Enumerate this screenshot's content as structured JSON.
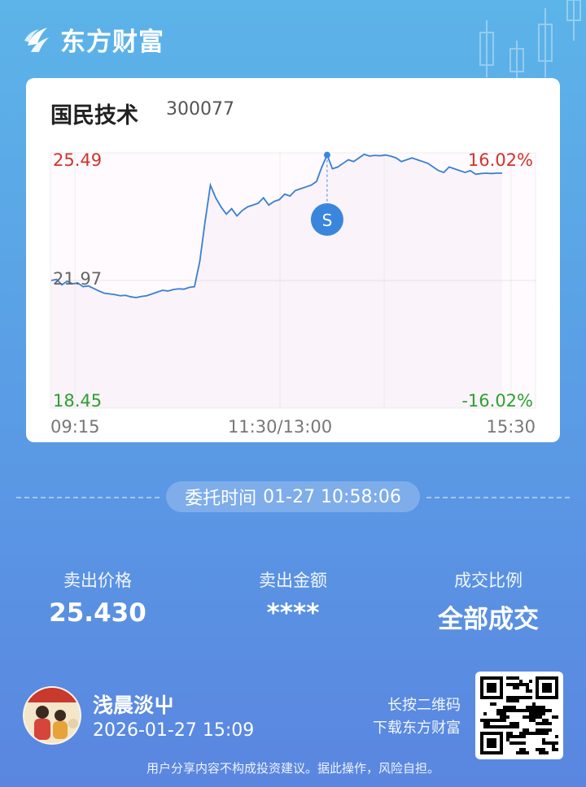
{
  "brand": {
    "name": "东方财富",
    "accent": "#ffffff"
  },
  "stock": {
    "name": "国民技术",
    "code": "300077"
  },
  "chart_data": {
    "type": "line",
    "y_left_ticks": [
      "25.49",
      "21.97",
      "18.45"
    ],
    "y_right_ticks": [
      "16.02%",
      "",
      "-16.02%"
    ],
    "x_ticks": [
      "09:15",
      "11:30/13:00",
      "15:30"
    ],
    "ylim": [
      18.45,
      25.49
    ],
    "prev_close": 21.97,
    "line_color": "#3a7fd0",
    "up_color": "#d0342c",
    "down_color": "#2ea02e",
    "marker": {
      "label": "S",
      "price": 25.43,
      "color": "#3a86dc"
    },
    "series": [
      {
        "values": [
          21.97,
          22.0,
          21.85,
          21.95,
          21.88,
          21.9,
          21.8,
          21.82,
          21.75,
          21.68,
          21.62,
          21.6,
          21.58,
          21.55,
          21.56,
          21.52,
          21.5,
          21.53,
          21.55,
          21.6,
          21.65,
          21.7,
          21.68,
          21.72,
          21.74,
          21.73,
          21.78,
          21.8,
          22.5,
          23.6,
          24.6,
          24.25,
          24.0,
          23.8,
          23.95,
          23.75,
          23.9,
          24.0,
          24.05,
          24.1,
          24.25,
          24.05,
          24.15,
          24.2,
          24.35,
          24.3,
          24.45,
          24.5,
          24.55,
          24.6,
          24.7,
          25.1,
          25.43,
          25.05,
          25.1,
          25.2,
          25.3,
          25.25,
          25.35,
          25.45,
          25.4,
          25.42,
          25.41,
          25.43,
          25.4,
          25.35,
          25.25,
          25.3,
          25.35,
          25.3,
          25.25,
          25.2,
          25.1,
          25.0,
          24.95,
          25.1,
          25.05,
          25.0,
          24.95,
          25.0,
          24.9,
          24.92,
          24.93,
          24.92,
          24.93,
          24.93
        ]
      }
    ]
  },
  "order": {
    "label": "委托时间",
    "time": "01-27 10:58:06"
  },
  "stats": [
    {
      "label": "卖出价格",
      "value": "25.430"
    },
    {
      "label": "卖出金额",
      "value": "****"
    },
    {
      "label": "成交比例",
      "value": "全部成交"
    }
  ],
  "user": {
    "name": "浅晨淡屮",
    "time": "2026-01-27 15:09"
  },
  "qr": {
    "hint_line1": "长按二维码",
    "hint_line2": "下载东方财富"
  },
  "disclaimer": "用户分享内容不构成投资建议。据此操作，风险自担。"
}
